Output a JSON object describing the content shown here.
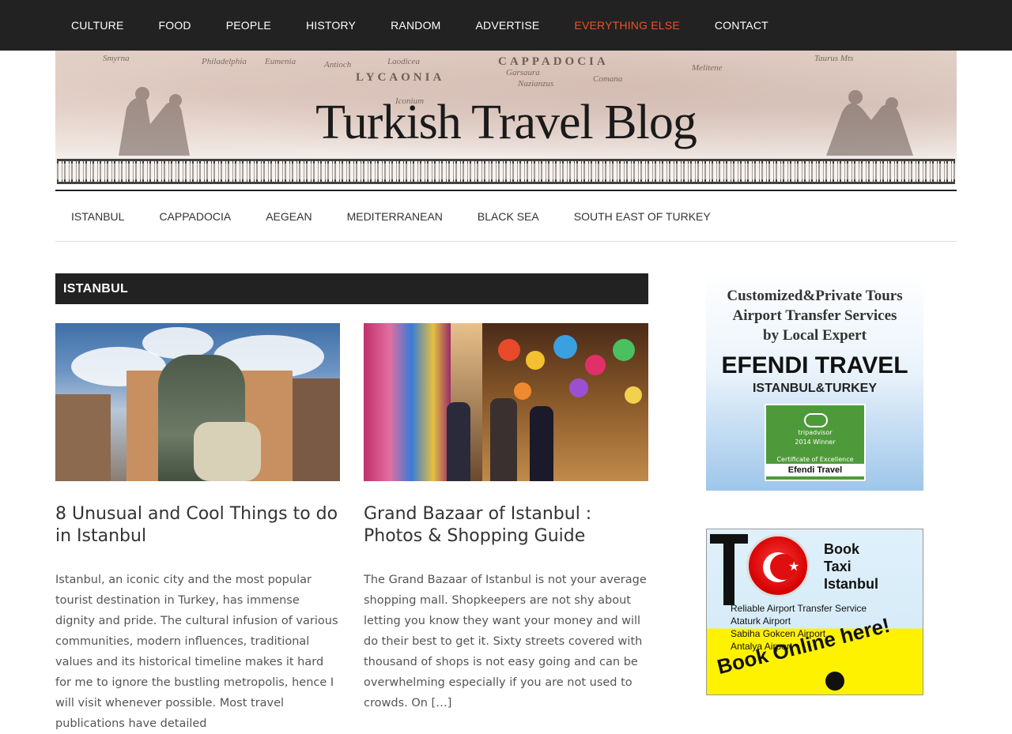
{
  "top_nav": {
    "items": [
      {
        "label": "CULTURE"
      },
      {
        "label": "FOOD"
      },
      {
        "label": "PEOPLE"
      },
      {
        "label": "HISTORY"
      },
      {
        "label": "RANDOM"
      },
      {
        "label": "ADVERTISE"
      },
      {
        "label": "EVERYTHING ELSE",
        "active": true
      },
      {
        "label": "CONTACT"
      }
    ],
    "active_color": "#f15123",
    "background": "#222222"
  },
  "header": {
    "site_title": "Turkish Travel Blog",
    "map_labels": [
      "Smyrna",
      "Philadelphia",
      "Eumenia",
      "Antioch",
      "LYCAONIA",
      "CAPPADOCIA",
      "Laodicea",
      "Iconium",
      "Garsaura",
      "Nazianzus",
      "Comana",
      "Melitene",
      "Taurus Mts"
    ]
  },
  "sub_nav": {
    "items": [
      {
        "label": "ISTANBUL"
      },
      {
        "label": "CAPPADOCIA"
      },
      {
        "label": "AEGEAN"
      },
      {
        "label": "MEDITERRANEAN"
      },
      {
        "label": "BLACK SEA"
      },
      {
        "label": "SOUTH EAST OF TURKEY"
      }
    ]
  },
  "archive": {
    "title": "ISTANBUL"
  },
  "posts": [
    {
      "title": "8 Unusual and Cool Things to do in Istanbul",
      "excerpt": "Istanbul, an iconic city and the most popular tourist destination in Turkey, has immense dignity and pride. The cultural infusion of various communities, modern influences, traditional values and its historical timeline makes it hard for me to ignore the bustling metropolis, hence I will visit whenever possible. Most travel publications have detailed"
    },
    {
      "title": "Grand Bazaar of Istanbul : Photos & Shopping Guide",
      "excerpt": "The Grand Bazaar of Istanbul is not your average shopping mall. Shopkeepers are not shy about letting you know  they want your money and will do their best to get it. Sixty streets covered with thousand of shops is not easy going and can be overwhelming especially if you are not used to crowds. On […]"
    }
  ],
  "sidebar": {
    "ad_efendi": {
      "line1": "Customized&Private Tours",
      "line2": "Airport Transfer Services",
      "line3": "by Local Expert",
      "brand": "EFENDI TRAVEL",
      "sub": "ISTANBUL&TURKEY",
      "cert_brand": "tripadvisor",
      "cert_year": "2014 Winner",
      "cert_label": "Certificate of Excellence",
      "cert_name": "Efendi Travel"
    },
    "ad_taxi": {
      "book_line1": "Book",
      "book_line2": "Taxi",
      "book_line3": "Istanbul",
      "service1": "Reliable Airport Transfer Service",
      "service2": "Ataturk Airport",
      "service3": "Sabiha Gokcen Airport",
      "service4": "Antalya Airport",
      "cta": "Book Online here!"
    }
  }
}
